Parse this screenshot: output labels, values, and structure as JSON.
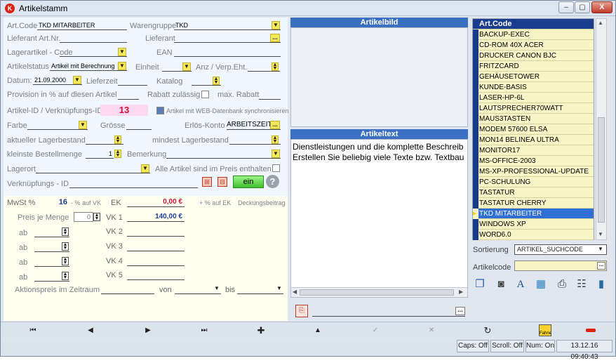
{
  "window": {
    "title": "Artikelstamm",
    "min": "–",
    "max": "▢",
    "close": "X"
  },
  "form": {
    "artcode_label": "Art.Code",
    "artcode_value": "TKD MITARBEITER",
    "warengruppe_label": "Warengruppe",
    "warengruppe_value": "TKD",
    "lief_artnr_label": "Lieferant Art.Nr.",
    "lieferant_label": "Lieferant",
    "lagerartikel_label": "Lagerartikel - Code",
    "ean_label": "EAN",
    "artikelstatus_label": "Artikelstatus",
    "artikelstatus_value": "Artikel mit Berechnung",
    "einheit_label": "Einheit",
    "anz_label": "Anz / Verp.Eht.",
    "datum_label": "Datum:",
    "datum_value": "21.09.2000",
    "lieferzeit_label": "Lieferzeit",
    "katalog_label": "Katalog",
    "provision_label": "Provision in % auf diesen Artikel",
    "rabatt_label": "Rabatt zulässig",
    "maxrabatt_label": "max. Rabatt",
    "artikelid_label": "Artikel-ID / Verknüpfungs-ID",
    "artikelid_value": "13",
    "web_sync_label": "Artikel mit WEB-Datenbank synchronisieren",
    "farbe_label": "Farbe",
    "groesse_label": "Grösse",
    "erloes_label": "Erlös-Konto",
    "erloes_value": "ARBEITSZEIT",
    "lagerbestand_label": "aktueller Lagerbestand",
    "mindest_label": "mindest Lagerbestand",
    "bestellmenge_label": "kleinste Bestellmenge",
    "bestellmenge_value": "1",
    "bemerkung_label": "Bemerkung",
    "lagerort_label": "Lagerort",
    "alle_artikel_label": "Alle Artikel sind im Preis enthalten",
    "verknuepfung_label": "Verknüpfungs - ID",
    "ein_label": "ein",
    "mwst_label": "MwSt %",
    "mwst_value": "16",
    "auf_vk_label": "- % auf VK",
    "ek_label": "EK",
    "ek_value": "0,00 €",
    "auf_ek_label": "+ % auf EK",
    "deckung_label": "Deckungsbeitrag",
    "preis_menge_label": "Preis je Menge",
    "preis_menge_value": "0",
    "ab_label": "ab",
    "vk1_label": "VK 1",
    "vk1_value": "140,00 €",
    "vk2_label": "VK 2",
    "vk3_label": "VK 3",
    "vk4_label": "VK 4",
    "vk5_label": "VK 5",
    "aktion_label": "Aktionspreis im Zeitraum",
    "von_label": "von",
    "bis_label": "bis"
  },
  "artikelbild": {
    "header": "Artikelbild"
  },
  "artikeltext": {
    "header": "Artikeltext",
    "lines": [
      "Dienstleistungen und die komplette Beschreib",
      "Erstellen Sie beliebig viele Texte bzw. Textbau"
    ]
  },
  "list": {
    "header": "Art.Code",
    "selected_index": 17,
    "items": [
      "BACKUP-EXEC",
      "CD-ROM 40X ACER",
      "DRUCKER CANON BJC",
      "FRITZCARD",
      "GEHÄUSETOWER",
      "KUNDE-BASIS",
      "LASER-HP-6L",
      "LAUTSPRECHER70WATT",
      "MAUS3TASTEN",
      "MODEM 57600 ELSA",
      "MON14 BELINEA ULTRA",
      "MONITOR17",
      "MS-OFFICE-2003",
      "MS-XP-PROFESSIONAL-UPDATE",
      "PC-SCHULUNG",
      "TASTATUR",
      "TASTATUR CHERRY",
      "TKD MITARBEITER",
      "WINDOWS XP",
      "WORD6.0"
    ]
  },
  "sort": {
    "label": "Sortierung",
    "value": "ARTIKEL_SUCHCODE",
    "artikelcode_label": "Artikelcode"
  },
  "toolbar": {
    "first": "⏮",
    "prev": "◀",
    "next": "▶",
    "last": "⏭",
    "add": "✚",
    "up": "▲",
    "fahne": "Fahne"
  },
  "statusbar": {
    "caps": "Caps: Off",
    "scroll": "Scroll: Off",
    "num": "Num: On",
    "datetime": "13.12.16 09:40:43"
  }
}
